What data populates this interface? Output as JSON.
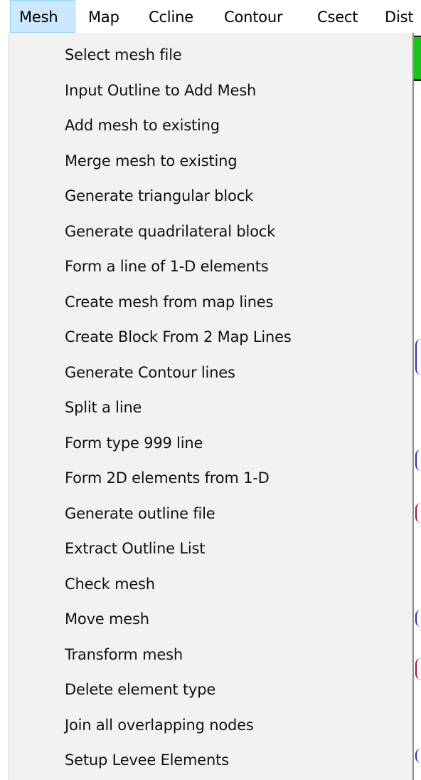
{
  "menubar": {
    "items": [
      {
        "label": "Mesh",
        "active": true
      },
      {
        "label": "Map",
        "active": false
      },
      {
        "label": "Ccline",
        "active": false
      },
      {
        "label": "Contour",
        "active": false
      },
      {
        "label": "Csect",
        "active": false
      },
      {
        "label": "Dist",
        "active": false
      }
    ]
  },
  "mesh_menu": {
    "items": [
      "Select mesh file",
      "Input Outline to Add Mesh",
      "Add mesh to existing",
      "Merge mesh to existing",
      "Generate triangular block",
      "Generate quadrilateral block",
      "Form a line of 1-D elements",
      "Create mesh from map lines",
      "Create Block From 2 Map Lines",
      "Generate Contour lines",
      "Split a line",
      "Form type 999 line",
      "Form 2D elements from 1-D",
      "Generate outline file",
      "Extract Outline List",
      "Check mesh",
      "Move mesh",
      "Transform mesh",
      "Delete element type",
      "Join all overlapping nodes",
      "Setup Levee Elements"
    ]
  },
  "colors": {
    "menubar_active_bg": "#cce8ff",
    "menubar_active_border": "#99d1ff",
    "dropdown_bg": "#f2f2f2",
    "background_window_accent": "#1bc41b"
  }
}
